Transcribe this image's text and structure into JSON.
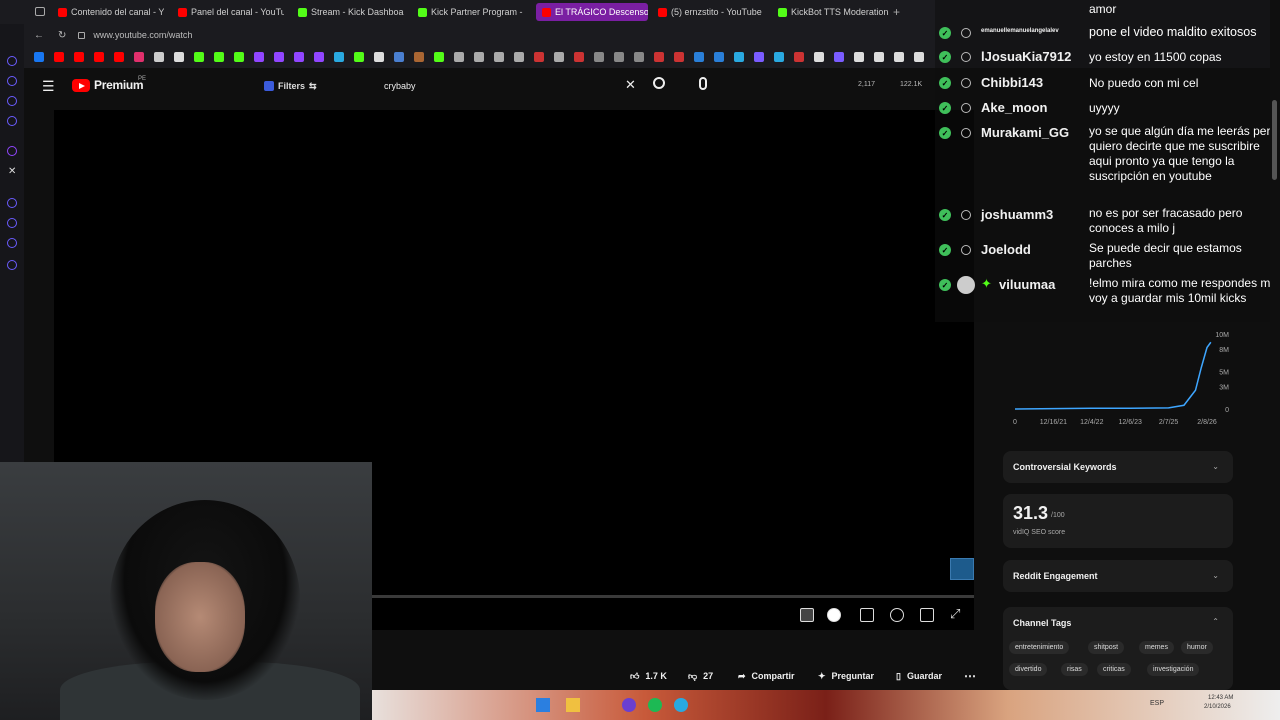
{
  "tabs": [
    {
      "label": "Contenido del canal - You",
      "color": "#ff0000"
    },
    {
      "label": "Panel del canal - YouTube",
      "color": "#ff0000"
    },
    {
      "label": "Stream - Kick Dashboard",
      "color": "#53fc18"
    },
    {
      "label": "Kick Partner Program - Ki",
      "color": "#53fc18"
    },
    {
      "label": "El TRÁGICO Descenso a l",
      "color": "#ff0000"
    },
    {
      "label": "(5) ernzstito - YouTube",
      "color": "#ff0000"
    },
    {
      "label": "KickBot TTS Moderation",
      "color": "#53fc18"
    }
  ],
  "address": {
    "url": "www.youtube.com/watch"
  },
  "youtube": {
    "logo_text": "Premium",
    "region": "PE",
    "filters_label": "Filters",
    "search_value": "crybaby",
    "stat_1": "2,117",
    "stat_2": "122.1K"
  },
  "actions": {
    "likes": "1.7 K",
    "dislikes": "27",
    "share": "Compartir",
    "ask": "Preguntar",
    "save": "Guardar"
  },
  "chat": [
    {
      "user": "",
      "text": "amor"
    },
    {
      "user": "emanuellemanuelangelalev",
      "text": "pone el video maldito exitosos"
    },
    {
      "user": "lJosuaKia7912",
      "text": "yo estoy en 11500 copas"
    },
    {
      "user": "Chibbi143",
      "text": "No puedo con mi cel"
    },
    {
      "user": "Ake_moon",
      "text": "uyyyy"
    },
    {
      "user": "Murakami_GG",
      "text": "yo se que algún día me leerás pero quiero decirte que me suscribire aqui pronto ya que tengo la suscripción en youtube"
    },
    {
      "user": "joshuamm3",
      "text": "no es por ser fracasado pero conoces a milo j"
    },
    {
      "user": "Joelodd",
      "text": "Se puede decir que estamos parches"
    },
    {
      "user": "viluumaa",
      "text": "!elmo mira como me respondes me voy a guardar mis 10mil kicks"
    }
  ],
  "chart_data": {
    "type": "area",
    "x": [
      "0",
      "12/16/21",
      "12/4/22",
      "12/6/23",
      "2/7/25",
      "2/8/26"
    ],
    "y_ticks": [
      "0",
      "3M",
      "5M",
      "8M",
      "10M"
    ],
    "ylim": [
      0,
      10000000
    ],
    "points": [
      [
        0,
        0
      ],
      [
        1,
        0.05
      ],
      [
        2,
        0.1
      ],
      [
        3,
        0.1
      ],
      [
        4,
        0.15
      ],
      [
        4.4,
        0.5
      ],
      [
        4.7,
        2.5
      ],
      [
        4.85,
        5.5
      ],
      [
        5,
        8.2
      ],
      [
        5.1,
        8.9
      ]
    ],
    "color": "#3ea6ff"
  },
  "sidebar": {
    "controversial": "Controversial Keywords",
    "seo_score": "31.3",
    "seo_max": "/100",
    "seo_label": "vidIQ SEO score",
    "reddit": "Reddit Engagement",
    "channel_tags": "Channel Tags",
    "tags": [
      "entretenimiento",
      "shitpost",
      "memes",
      "humor",
      "divertido",
      "risas",
      "criticas",
      "investigación"
    ]
  },
  "taskbar": {
    "lang": "ESP",
    "time": "12:43 AM",
    "date": "2/10/2026"
  }
}
